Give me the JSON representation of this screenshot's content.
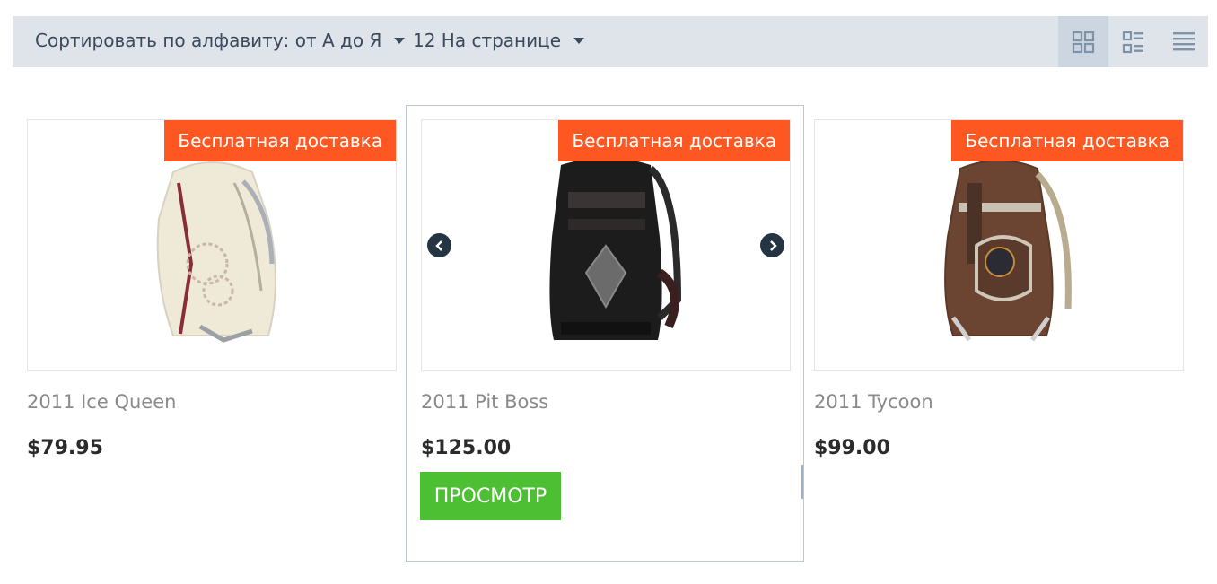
{
  "toolbar": {
    "sort_label": "Сортировать по алфавиту: от А до Я",
    "per_page_label": "12 На странице",
    "views": [
      {
        "name": "grid",
        "active": true
      },
      {
        "name": "list-grid",
        "active": false
      },
      {
        "name": "list",
        "active": false
      }
    ]
  },
  "products": [
    {
      "badge": "Бесплатная доставка",
      "name": "2011 Ice Queen",
      "price": "$79.95"
    },
    {
      "badge": "Бесплатная доставка",
      "name": "2011 Pit Boss",
      "price": "$125.00"
    },
    {
      "badge": "Бесплатная доставка",
      "name": "2011 Tycoon",
      "price": "$99.00"
    }
  ],
  "hovered_card": {
    "view_button_label": "ПРОСМОТР"
  },
  "colors": {
    "toolbar_bg": "#dfe4eb",
    "badge": "#ff5722",
    "button": "#4cbf32",
    "text_dark": "#3a4a5c",
    "arrow_bg": "#253443"
  }
}
